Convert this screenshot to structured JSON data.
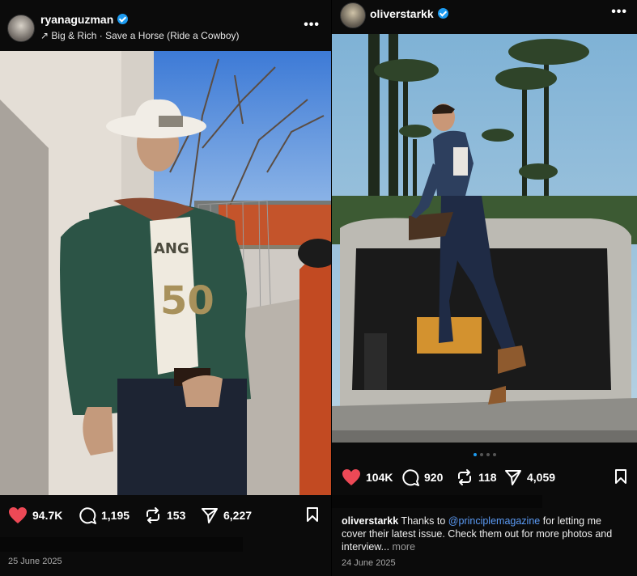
{
  "left_post": {
    "username": "ryanaguzman",
    "audio_arrow": "↗",
    "audio": "Big & Rich · Save a Horse (Ride a Cowboy)",
    "more": "•••",
    "likes": "94.7K",
    "comments": "1,195",
    "reposts": "153",
    "shares": "6,227",
    "date": "25 June 2025"
  },
  "right_post": {
    "username": "oliverstarkk",
    "more": "•••",
    "likes": "104K",
    "comments": "920",
    "reposts": "118",
    "shares": "4,059",
    "caption_user": "oliverstarkk",
    "caption_pre": " Thanks to ",
    "caption_mention": "@principlemagazine",
    "caption_post": " for letting me cover their latest issue. Check them out for more photos and interview...",
    "caption_more": " more",
    "date": "24 June 2025"
  },
  "colors": {
    "like_red": "#ed4956",
    "verified_blue": "#1d9bf0",
    "mention_blue": "#5b9bf5"
  }
}
